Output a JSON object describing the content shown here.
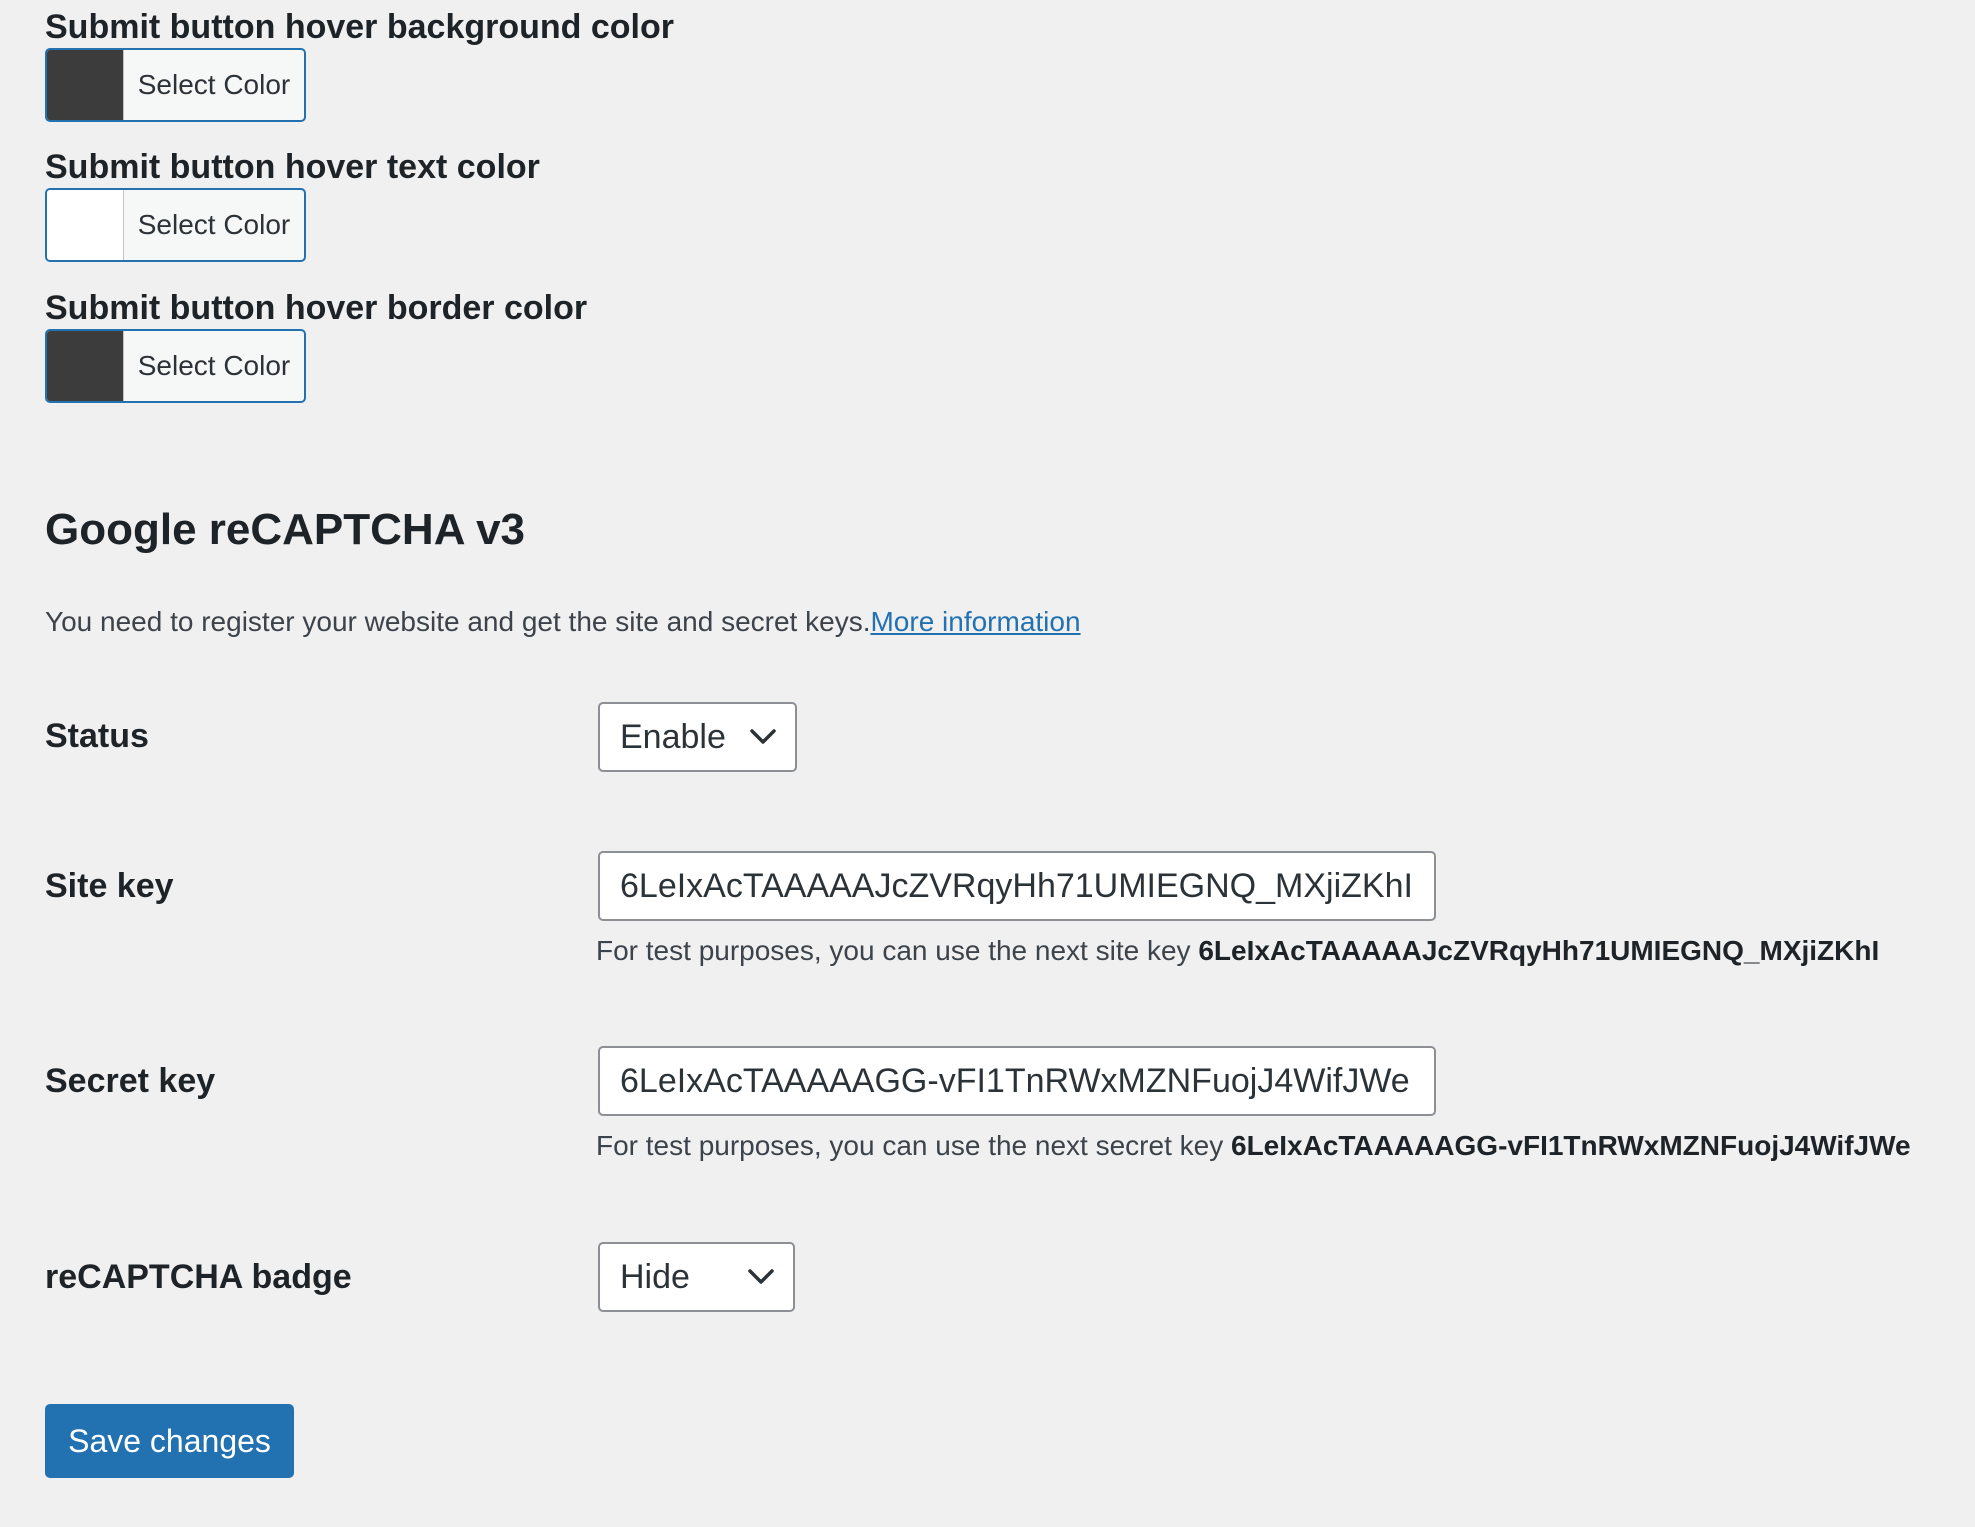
{
  "color_fields": [
    {
      "label": "Submit button hover background color",
      "button_label": "Select Color",
      "color": "#3c3c3c"
    },
    {
      "label": "Submit button hover text color",
      "button_label": "Select Color",
      "color": "#ffffff"
    },
    {
      "label": "Submit button hover border color",
      "button_label": "Select Color",
      "color": "#3c3c3c"
    }
  ],
  "recaptcha": {
    "title": "Google reCAPTCHA v3",
    "description": "You need to register your website and get the site and secret keys.",
    "more_info_link": "More information",
    "status": {
      "label": "Status",
      "selected": "Enable"
    },
    "site_key": {
      "label": "Site key",
      "value": "6LeIxAcTAAAAAJcZVRqyHh71UMIEGNQ_MXjiZKhI",
      "hint_prefix": "For test purposes, you can use the next site key",
      "hint_key": "6LeIxAcTAAAAAJcZVRqyHh71UMIEGNQ_MXjiZKhI"
    },
    "secret_key": {
      "label": "Secret key",
      "value": "6LeIxAcTAAAAAGG-vFI1TnRWxMZNFuojJ4WifJWe",
      "hint_prefix": "For test purposes, you can use the next secret key",
      "hint_key": "6LeIxAcTAAAAAGG-vFI1TnRWxMZNFuojJ4WifJWe"
    },
    "badge": {
      "label": "reCAPTCHA badge",
      "selected": "Hide"
    }
  },
  "save_label": "Save changes",
  "colors": {
    "accent": "#2271b1",
    "background": "#f0f0f1"
  }
}
